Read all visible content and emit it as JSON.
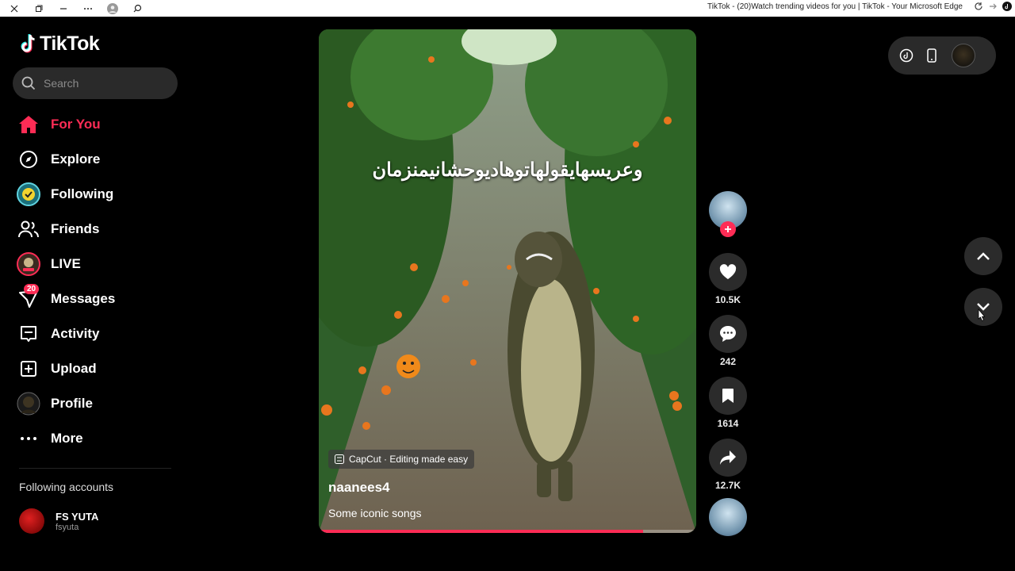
{
  "window": {
    "title": "TikTok - (20)Watch trending videos for you | TikTok - Your Microsoft Edge"
  },
  "sidebar": {
    "logo": "TikTok",
    "search": {
      "placeholder": "Search"
    },
    "items": [
      {
        "label": "For You",
        "icon": "home-icon",
        "active": true
      },
      {
        "label": "Explore",
        "icon": "compass-icon"
      },
      {
        "label": "Following",
        "icon": "following-avatar-icon"
      },
      {
        "label": "Friends",
        "icon": "friends-icon"
      },
      {
        "label": "LIVE",
        "icon": "live-avatar-icon"
      },
      {
        "label": "Messages",
        "icon": "messages-icon",
        "badge": "20"
      },
      {
        "label": "Activity",
        "icon": "activity-icon"
      },
      {
        "label": "Upload",
        "icon": "upload-icon"
      },
      {
        "label": "Profile",
        "icon": "profile-avatar-icon"
      },
      {
        "label": "More",
        "icon": "more-icon"
      }
    ],
    "following_title": "Following accounts",
    "accounts": [
      {
        "name": "FS YUTA",
        "handle": "fsyuta"
      }
    ]
  },
  "video": {
    "caption_overlay": "وعريسهايقولهاتوهاديوحشانيمنزمان",
    "effect_label": "CapCut · Editing made easy",
    "username": "naanees4",
    "description": "Some iconic songs",
    "progress": 0.86
  },
  "actions": {
    "likes": "10.5K",
    "comments": "242",
    "saves": "1614",
    "shares": "12.7K"
  },
  "colors": {
    "accent": "#fe2c55",
    "background": "#000000",
    "surface": "#2b2b2b"
  }
}
